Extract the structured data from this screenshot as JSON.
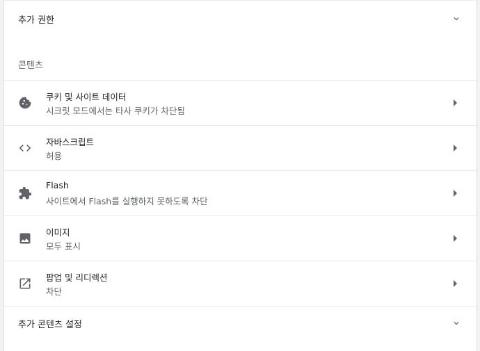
{
  "additional_permissions": {
    "label": "추가 권한",
    "icon": "chevron-down-icon"
  },
  "content_section": {
    "title": "콘텐츠"
  },
  "items": [
    {
      "id": "cookies",
      "icon": "cookie-icon",
      "title": "쿠키 및 사이트 데이터",
      "subtitle": "시크릿 모드에서는 타사 쿠키가 차단됨"
    },
    {
      "id": "javascript",
      "icon": "code-icon",
      "title": "자바스크립트",
      "subtitle": "허용"
    },
    {
      "id": "flash",
      "icon": "puzzle-icon",
      "title": "Flash",
      "subtitle": "사이트에서 Flash를 실행하지 못하도록 차단"
    },
    {
      "id": "images",
      "icon": "image-icon",
      "title": "이미지",
      "subtitle": "모두 표시"
    },
    {
      "id": "popups",
      "icon": "open-in-new-icon",
      "title": "팝업 및 리디렉션",
      "subtitle": "차단"
    }
  ],
  "additional_content_settings": {
    "label": "추가 콘텐츠 설정",
    "icon": "chevron-down-icon"
  },
  "colors": {
    "primary_text": "#202124",
    "secondary_text": "#5f6368",
    "icon": "#5f6368",
    "divider": "#e8eaed"
  }
}
